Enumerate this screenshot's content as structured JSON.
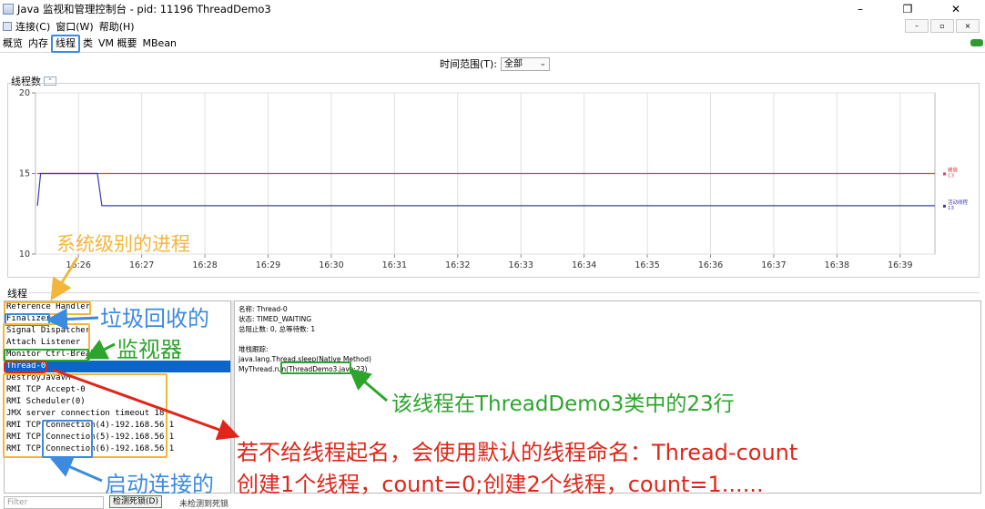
{
  "window": {
    "title": "Java 监视和管理控制台 - pid: 11196 ThreadDemo3",
    "controls": [
      "–",
      "❐",
      "✕"
    ]
  },
  "menu": {
    "items": [
      "连接(C)",
      "窗口(W)",
      "帮助(H)"
    ]
  },
  "mdi_controls": [
    "–",
    "▫",
    "×"
  ],
  "tabs": {
    "items": [
      "概览",
      "内存",
      "线程",
      "类",
      "VM 概要",
      "MBean"
    ],
    "active_index": 2
  },
  "time_range": {
    "label": "时间范围(T):",
    "value": "全部"
  },
  "chart_section": {
    "title": "线程数"
  },
  "chart_data": {
    "type": "line",
    "title": "线程数",
    "x_tick_labels": [
      "16:26",
      "16:27",
      "16:28",
      "16:29",
      "16:30",
      "16:31",
      "16:32",
      "16:33",
      "16:34",
      "16:35",
      "16:36",
      "16:37",
      "16:38",
      "16:39"
    ],
    "y_ticks": [
      10,
      15,
      20
    ],
    "ylim": [
      10,
      20
    ],
    "xlim": [
      -0.68,
      13.55
    ],
    "grid": true,
    "series": [
      {
        "name": "峰值",
        "color": "#e04040",
        "current": "13",
        "points": [
          [
            -0.65,
            15
          ],
          [
            13.55,
            15
          ]
        ]
      },
      {
        "name": "活动线程",
        "color": "#3b3bb5",
        "current": "13",
        "points": [
          [
            -0.65,
            13
          ],
          [
            -0.6,
            15
          ],
          [
            0.3,
            15
          ],
          [
            0.37,
            13
          ],
          [
            13.55,
            13
          ]
        ]
      }
    ]
  },
  "threads_section": {
    "title": "线程"
  },
  "threads": [
    "Reference Handler",
    "Finalizer",
    "Signal Dispatcher",
    "Attach Listener",
    "Monitor Ctrl-Break",
    "Thread-0",
    "DestroyJavaVM",
    "RMI TCP Accept-0",
    "RMI Scheduler(0)",
    "JMX server connection timeout 18",
    "RMI TCP Connection(4)-192.168.56.1",
    "RMI TCP Connection(5)-192.168.56.1",
    "RMI TCP Connection(6)-192.168.56.1"
  ],
  "selected_thread_index": 5,
  "detail": {
    "name_line": "名称: Thread-0",
    "state_line": "状态: TIMED_WAITING",
    "counts_line": "总阻止数: 0, 总等待数: 1",
    "stack_title": "堆栈跟踪:",
    "stack_line1": "java.lang.Thread.sleep(Native Method)",
    "stack_line2": "MyThread.run(ThreadDemo3.java:23)"
  },
  "filter_placeholder": "Filter",
  "detect_deadlock_label": "检测死锁(D)",
  "no_deadlock_label": "未检测到死锁",
  "annotations": {
    "system": "系统级别的进程",
    "gc": "垃圾回收的",
    "monitor": "监视器",
    "line23": "该线程在ThreadDemo3类中的23行",
    "naming_1": "若不给线程起名，会使用默认的线程命名：Thread-count",
    "naming_2": "创建1个线程，count=0;创建2个线程，count=1......",
    "connect": "启动连接的"
  },
  "colors": {
    "accent_blue": "#3c8be0",
    "accent_orange": "#f4b63a",
    "accent_green": "#2ca52c",
    "accent_red": "#e0261a",
    "selection": "#0a66c8"
  }
}
